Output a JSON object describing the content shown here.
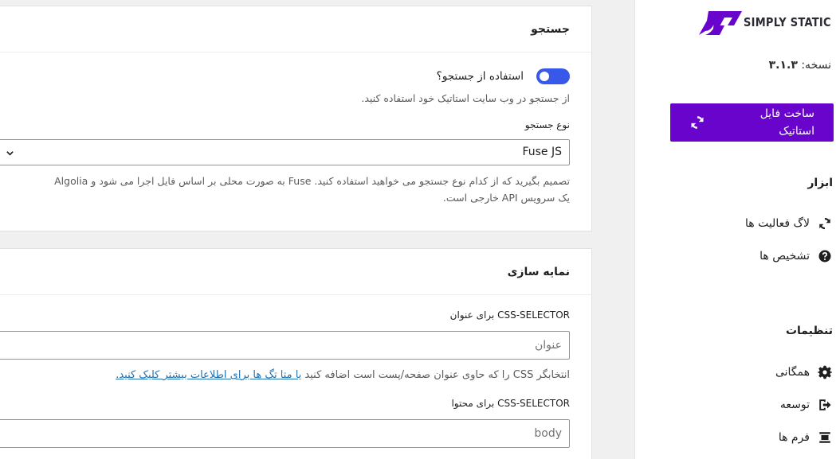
{
  "sidebar": {
    "logo_text": "SIMPLY STATIC",
    "version_label": "نسخه:",
    "version_value": "۳.۱.۳",
    "generate_label": "ساخت فایل استاتیک",
    "tools_title": "ابزار",
    "tools": [
      {
        "label": "لاگ فعالیت ها",
        "icon": "sync-icon"
      },
      {
        "label": "تشخیص ها",
        "icon": "help-icon"
      }
    ],
    "settings_title": "تنظیمات",
    "settings": [
      {
        "label": "همگانی",
        "icon": "gear-icon"
      },
      {
        "label": "توسعه",
        "icon": "exit-icon"
      },
      {
        "label": "فرم ها",
        "icon": "form-icon"
      }
    ],
    "accent": "#6804cc"
  },
  "search_card": {
    "title": "جستجو",
    "toggle_label": "استفاده از جستجو؟",
    "toggle_on": true,
    "toggle_help": "از جستجو در وب سایت استاتیک خود استفاده کنید.",
    "type_label": "نوع جستجو",
    "type_value": "Fuse JS",
    "type_help_1": "تصمیم بگیرید که از کدام نوع جستجو می خواهید استفاده کنید. Fuse به صورت محلی بر اساس فایل اجرا می شود و Algolia",
    "type_help_2": "یک سرویس API خارجی است.",
    "toggle_color": "#3858e9"
  },
  "index_card": {
    "title": "نمایه سازی",
    "title_selector_label": "CSS-SELECTOR برای عنوان",
    "title_selector_placeholder": "عنوان",
    "title_help_text": "انتخابگر CSS را که حاوی عنوان صفحه/پست است اضافه کنید",
    "title_help_link": "یا متا تگ ها برای اطلاعات بیشتر کلیک کنید.",
    "content_selector_label": "CSS-SELECTOR برای محتوا",
    "content_selector_placeholder": "body",
    "link_color": "#2271b1"
  }
}
